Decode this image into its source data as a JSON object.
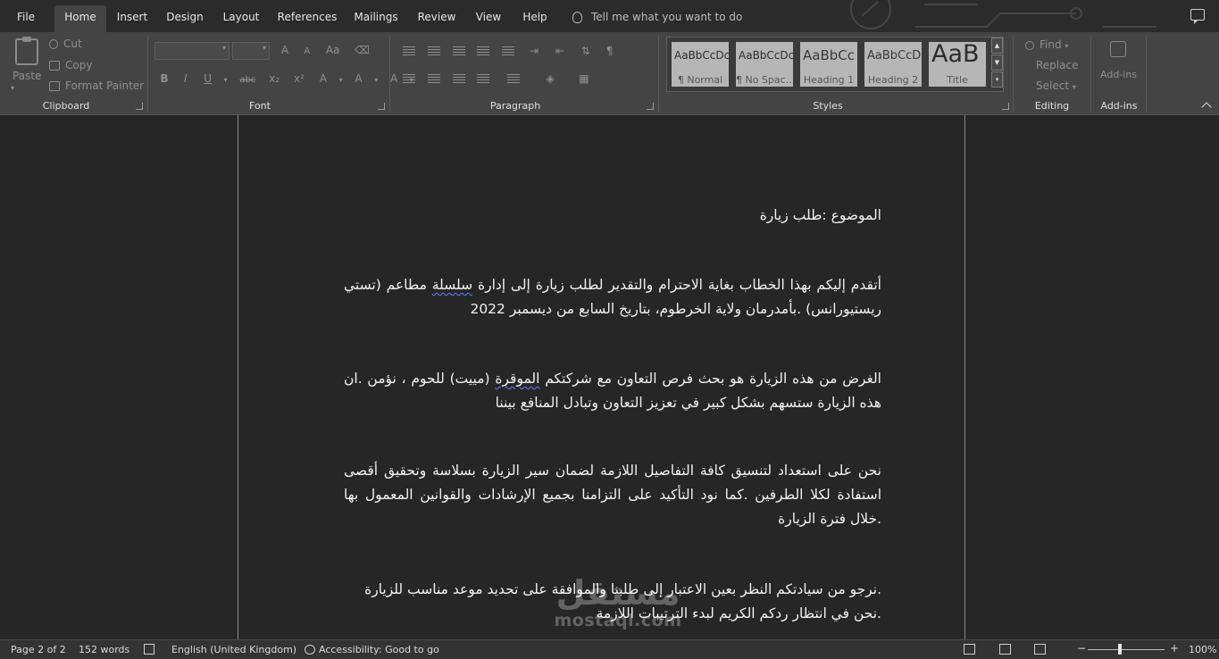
{
  "tabs": [
    {
      "label": "File"
    },
    {
      "label": "Home",
      "active": true
    },
    {
      "label": "Insert"
    },
    {
      "label": "Design"
    },
    {
      "label": "Layout"
    },
    {
      "label": "References"
    },
    {
      "label": "Mailings"
    },
    {
      "label": "Review"
    },
    {
      "label": "View"
    },
    {
      "label": "Help"
    }
  ],
  "tell_me": "Tell me what you want to do",
  "ribbon": {
    "clipboard": {
      "label": "Clipboard",
      "paste": "Paste",
      "cut": "Cut",
      "copy": "Copy",
      "format_painter": "Format Painter"
    },
    "font": {
      "label": "Font",
      "grow": "A",
      "shrink": "A",
      "case": "Aa",
      "bold": "B",
      "italic": "I",
      "underline": "U",
      "strike": "abc",
      "subscript": "x₂",
      "superscript": "x²",
      "effects": "A",
      "highlight": "A",
      "color": "A"
    },
    "paragraph": {
      "label": "Paragraph",
      "pilcrow": "¶"
    },
    "styles": {
      "label": "Styles",
      "items": [
        {
          "sample": "AaBbCcDc",
          "name": "¶ Normal"
        },
        {
          "sample": "AaBbCcDc",
          "name": "¶ No Spac..."
        },
        {
          "sample": "AaBbCc",
          "name": "Heading 1"
        },
        {
          "sample": "AaBbCcD",
          "name": "Heading 2"
        },
        {
          "sample": "AaB",
          "name": "Title"
        }
      ]
    },
    "editing": {
      "label": "Editing",
      "find": "Find",
      "replace": "Replace",
      "select": "Select"
    },
    "addins": {
      "label": "Add-ins",
      "button": "Add-ins"
    }
  },
  "document": {
    "subject": "الموضوع :طلب زيارة",
    "p1_before": "أتقدم إليكم بهذا الخطاب بغاية الاحترام والتقدير لطلب زيارة إلى إدارة ",
    "p1_spell": "سلسلة",
    "p1_after": " مطاعم (تستي ريستيورانس) .بأمدرمان ولاية الخرطوم، بتاريخ السابع من ديسمبر 2022",
    "p2_before": "الغرض من هذه الزيارة هو بحث فرص التعاون مع شركتكم ",
    "p2_spell": "الموقرة",
    "p2_after": " (مييت)  للحوم ، نؤمن .ان هذه الزيارة ستسهم بشكل كبير في تعزيز التعاون وتبادل المنافع بيننا",
    "p3": "نحن على استعداد لتنسيق كافة التفاصيل اللازمة لضمان سير الزيارة بسلاسة وتحقيق أقصى استفادة لكلا الطرفين .كما نود التأكيد على التزامنا بجميع الإرشادات والقوانين المعمول بها .خلال فترة الزيارة",
    "p4_line1": ".نرجو من سيادتكم النظر بعين الاعتبار إلى طلبنا والموافقة على تحديد موعد مناسب للزيارة",
    "p4_line2": ".نحن في انتظار ردكم الكريم لبدء الترتيبات اللازمة"
  },
  "watermark": {
    "arabic": "مستقل",
    "latin": "mostaql.com"
  },
  "status": {
    "page": "Page 2 of 2",
    "words": "152 words",
    "language": "English (United Kingdom)",
    "accessibility": "Accessibility: Good to go",
    "zoom": "100%"
  }
}
